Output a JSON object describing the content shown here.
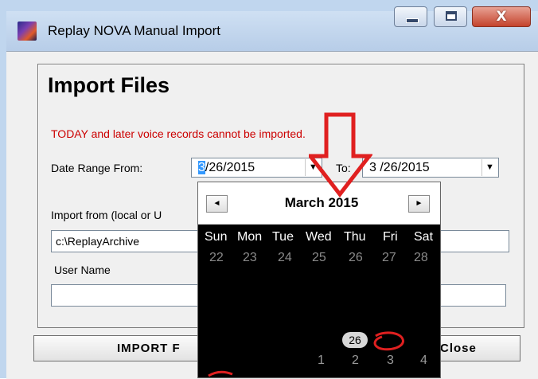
{
  "window": {
    "title": "Replay NOVA Manual Import",
    "close_glyph": "X"
  },
  "dialog": {
    "heading": "Import Files",
    "warning": "TODAY and later voice records cannot be imported.",
    "date_from_label": "Date Range From:",
    "date_from_sel": "3",
    "date_from_rest": "/26/2015",
    "date_to_label": "To:",
    "date_to_value": "3 /26/2015",
    "import_from_label": "Import from (local or U",
    "import_from_value": "c:\\ReplayArchive",
    "user_name_label": "User Name",
    "user_name_value": "",
    "import_button": "IMPORT F",
    "close_button": "Close"
  },
  "calendar": {
    "month_label": "March 2015",
    "prev_glyph": "◄",
    "next_glyph": "►",
    "weekdays": [
      "Sun",
      "Mon",
      "Tue",
      "Wed",
      "Thu",
      "Fri",
      "Sat"
    ],
    "row1": [
      "22",
      "23",
      "24",
      "25",
      "26",
      "27",
      "28"
    ],
    "today": "26",
    "row_last": [
      "1",
      "2",
      "3",
      "4"
    ]
  },
  "colors": {
    "warning": "#cc0000",
    "annotation": "#e02020",
    "selection": "#3399ff"
  },
  "icons": [
    "app-icon",
    "minimize-icon",
    "maximize-icon",
    "close-icon",
    "dropdown-arrow-icon",
    "prev-month-icon",
    "next-month-icon"
  ]
}
